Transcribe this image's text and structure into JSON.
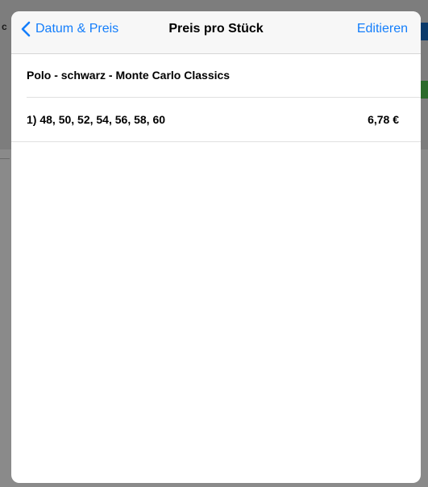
{
  "background": {
    "partial_label": "c"
  },
  "navbar": {
    "back_label": "Datum & Preis",
    "title": "Preis pro Stück",
    "edit_label": "Editieren"
  },
  "product": {
    "name": "Polo - schwarz - Monte Carlo Classics"
  },
  "price_rows": [
    {
      "sizes": "1) 48, 50, 52, 54, 56, 58, 60",
      "price": "6,78 €"
    }
  ],
  "colors": {
    "accent": "#147efb",
    "navbar_bg": "#f7f7f7",
    "dim_bg": "#7f7f7f"
  }
}
